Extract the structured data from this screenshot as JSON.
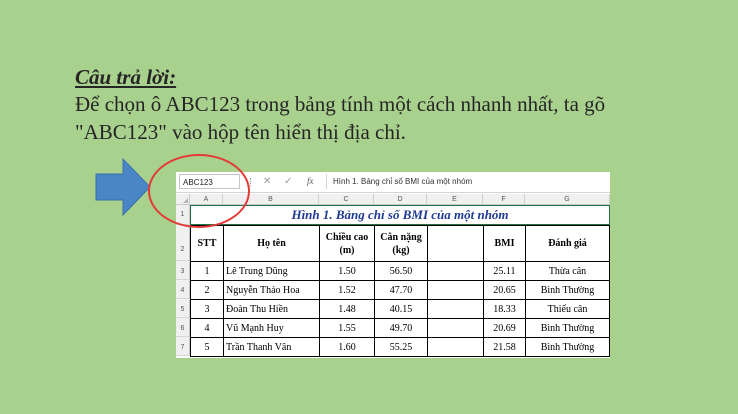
{
  "slide": {
    "heading": "Câu trả lời:",
    "body_line1": "Để chọn ô ABC123 trong bảng tính một cách nhanh nhất, ta gõ",
    "body_line2": "\"ABC123\" vào hộp tên hiển thị địa chỉ."
  },
  "colors": {
    "background": "#a9d18e",
    "arrow": "#4a86c6",
    "circle": "#e53935",
    "title_text": "#1f3a93"
  },
  "excel": {
    "name_box": "ABC123",
    "formula_buttons": {
      "cancel": "✕",
      "enter": "✓",
      "fx": "fx"
    },
    "formula_content": "Hình 1. Bảng chỉ số BMI của một nhóm",
    "columns": [
      "A",
      "B",
      "C",
      "D",
      "E",
      "F",
      "G"
    ],
    "rows": [
      "1",
      "2",
      "3",
      "4",
      "5",
      "6",
      "7"
    ],
    "table_title": "Hình 1. Bảng chỉ số BMI của một nhóm",
    "headers": {
      "stt": "STT",
      "name": "Họ tên",
      "height": "Chiều cao (m)",
      "weight": "Cân nặng (kg)",
      "blank": "",
      "bmi": "BMI",
      "rating": "Đánh giá"
    },
    "data": [
      {
        "stt": "1",
        "name": "Lê Trung Dũng",
        "height": "1.50",
        "weight": "56.50",
        "bmi": "25.11",
        "rating": "Thừa cân"
      },
      {
        "stt": "2",
        "name": "Nguyễn Thảo Hoa",
        "height": "1.52",
        "weight": "47.70",
        "bmi": "20.65",
        "rating": "Bình Thường"
      },
      {
        "stt": "3",
        "name": "Đoàn Thu Hiền",
        "height": "1.48",
        "weight": "40.15",
        "bmi": "18.33",
        "rating": "Thiếu cân"
      },
      {
        "stt": "4",
        "name": "Vũ Mạnh Huy",
        "height": "1.55",
        "weight": "49.70",
        "bmi": "20.69",
        "rating": "Bình Thường"
      },
      {
        "stt": "5",
        "name": "Trần Thanh Vân",
        "height": "1.60",
        "weight": "55.25",
        "bmi": "21.58",
        "rating": "Bình Thường"
      }
    ]
  }
}
